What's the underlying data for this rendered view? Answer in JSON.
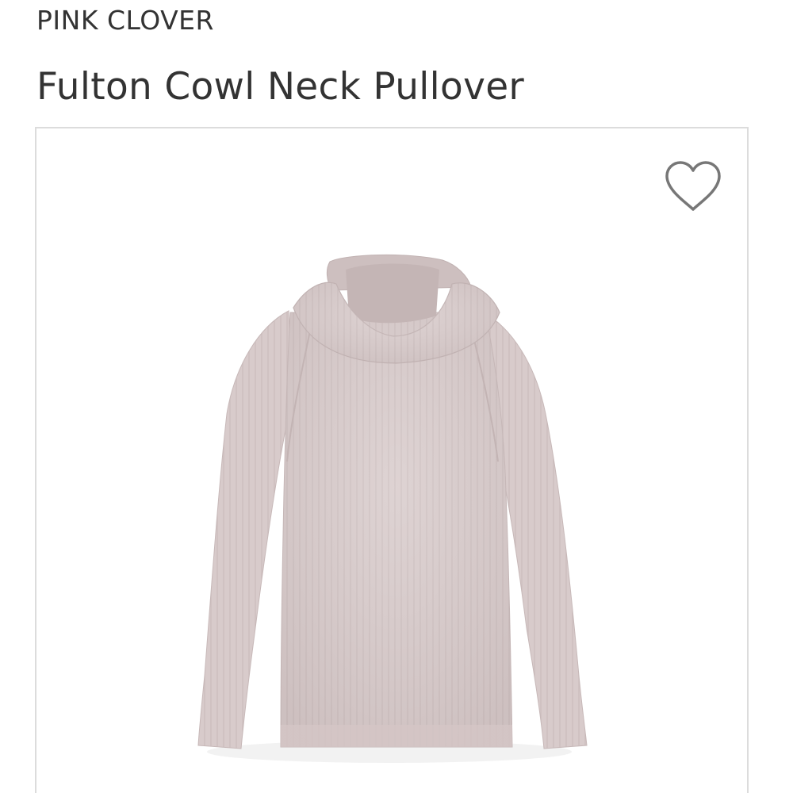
{
  "product": {
    "brand": "PINK CLOVER",
    "name": "Fulton Cowl Neck Pullover",
    "image": {
      "icon": "cowl-neck-sweater-image",
      "garment_color": "#d8cbcb"
    },
    "favorite": {
      "icon": "heart-outline-icon",
      "selected": false
    }
  },
  "colors": {
    "text": "#333333",
    "card_border": "#dcdcdc",
    "icon_stroke": "#777777"
  }
}
